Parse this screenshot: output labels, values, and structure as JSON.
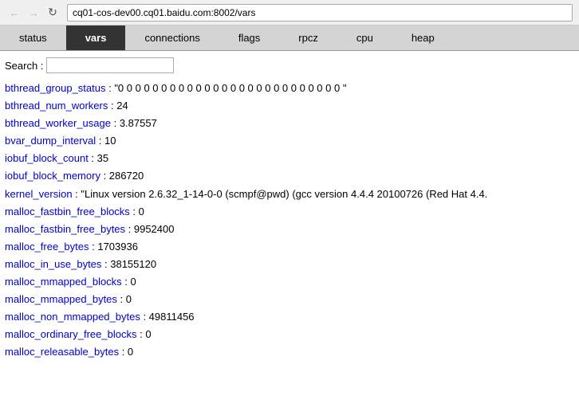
{
  "browser": {
    "url": "cq01-cos-dev00.cq01.baidu.com:8002/vars",
    "back_label": "←",
    "forward_label": "→",
    "refresh_label": "↻"
  },
  "tabs": [
    {
      "id": "status",
      "label": "status",
      "active": false
    },
    {
      "id": "vars",
      "label": "vars",
      "active": true
    },
    {
      "id": "connections",
      "label": "connections",
      "active": false
    },
    {
      "id": "flags",
      "label": "flags",
      "active": false
    },
    {
      "id": "rpcz",
      "label": "rpcz",
      "active": false
    },
    {
      "id": "cpu",
      "label": "cpu",
      "active": false
    },
    {
      "id": "heap",
      "label": "heap",
      "active": false
    }
  ],
  "search": {
    "label": "Search :",
    "placeholder": ""
  },
  "vars": [
    {
      "key": "bthread_group_status",
      "value": " : \"0 0 0 0 0 0 0 0 0 0 0 0 0 0 0 0 0 0 0 0 0 0 0 0 0 0 \""
    },
    {
      "key": "bthread_num_workers",
      "value": " : 24"
    },
    {
      "key": "bthread_worker_usage",
      "value": " : 3.87557"
    },
    {
      "key": "bvar_dump_interval",
      "value": " : 10"
    },
    {
      "key": "iobuf_block_count",
      "value": " : 35"
    },
    {
      "key": "iobuf_block_memory",
      "value": " : 286720"
    },
    {
      "key": "kernel_version",
      "value": " : \"Linux version 2.6.32_1-14-0-0 (scmpf@pwd) (gcc version 4.4.4 20100726 (Red Hat 4.4."
    },
    {
      "key": "malloc_fastbin_free_blocks",
      "value": " : 0"
    },
    {
      "key": "malloc_fastbin_free_bytes",
      "value": " : 9952400"
    },
    {
      "key": "malloc_free_bytes",
      "value": " : 1703936"
    },
    {
      "key": "malloc_in_use_bytes",
      "value": " : 38155120"
    },
    {
      "key": "malloc_mmapped_blocks",
      "value": " : 0"
    },
    {
      "key": "malloc_mmapped_bytes",
      "value": " : 0"
    },
    {
      "key": "malloc_non_mmapped_bytes",
      "value": " : 49811456"
    },
    {
      "key": "malloc_ordinary_free_blocks",
      "value": " : 0"
    },
    {
      "key": "malloc_releasable_bytes",
      "value": " : 0"
    }
  ]
}
